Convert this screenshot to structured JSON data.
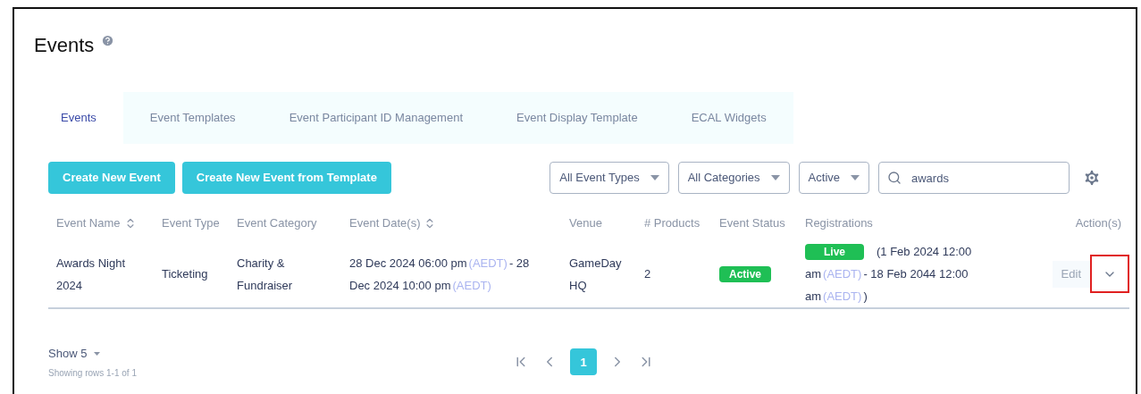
{
  "title": "Events",
  "tabs": [
    {
      "label": "Events",
      "selected": true
    },
    {
      "label": "Event Templates",
      "selected": false
    },
    {
      "label": "Event Participant ID Management",
      "selected": false
    },
    {
      "label": "Event Display Template",
      "selected": false
    },
    {
      "label": "ECAL Widgets",
      "selected": false
    }
  ],
  "buttons": [
    "Create New Event",
    "Create New Event from Template"
  ],
  "filters": [
    "All Event Types",
    "All Categories",
    "Active"
  ],
  "search": {
    "value": "awards"
  },
  "table": {
    "columns": [
      {
        "label": "Event Name",
        "sortable": true
      },
      {
        "label": "Event Type",
        "sortable": false
      },
      {
        "label": "Event Category",
        "sortable": false
      },
      {
        "label": "Event Date(s)",
        "sortable": true
      },
      {
        "label": "Venue",
        "sortable": false
      },
      {
        "label": "# Products",
        "sortable": false
      },
      {
        "label": "Event Status",
        "sortable": false
      },
      {
        "label": "Registrations",
        "sortable": false
      },
      {
        "label": "Action(s)",
        "sortable": false
      }
    ],
    "rows": [
      {
        "name": "Awards Night 2024",
        "type": "Ticketing",
        "category": "Charity & Fundraiser",
        "dates": [
          {
            "kind": "text",
            "text": "28 Dec 2024 06:00 pm"
          },
          {
            "kind": "tz",
            "text": "(AEDT)"
          },
          {
            "kind": "text",
            "text": "- 28 Dec 2024 10:00 pm"
          },
          {
            "kind": "tz",
            "text": "(AEDT)"
          }
        ],
        "venue": "GameDay HQ",
        "products": "2",
        "status": "Active",
        "registration_badge": "Live",
        "registrations": [
          {
            "kind": "text",
            "text": "(1 Feb 2024 12:00 am"
          },
          {
            "kind": "tz",
            "text": "(AEDT)"
          },
          {
            "kind": "text",
            "text": "- 18 Feb 2044 12:00 am"
          },
          {
            "kind": "tz",
            "text": "(AEDT)"
          },
          {
            "kind": "text",
            "text": ")"
          }
        ],
        "edit": "Edit",
        "menu_highlighted": true
      }
    ]
  },
  "footer": {
    "show": "Show 5",
    "showing": "Showing rows 1-1 of 1",
    "pages": [
      {
        "label": "1",
        "selected": true
      }
    ]
  }
}
